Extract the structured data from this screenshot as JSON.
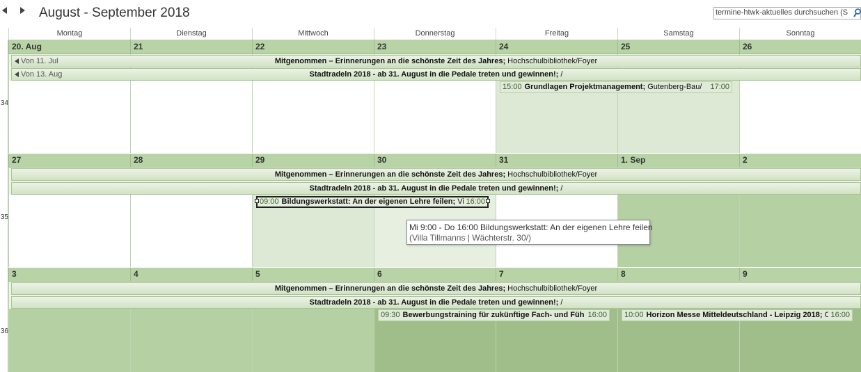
{
  "header": {
    "title": "August - September 2018",
    "search_placeholder": "termine-htwk-aktuelles durchsuchen (S"
  },
  "day_names": [
    "Montag",
    "Dienstag",
    "Mittwoch",
    "Donnerstag",
    "Freitag",
    "Samstag",
    "Sonntag"
  ],
  "weeks": [
    {
      "week_number": "34",
      "dates": [
        "20. Aug",
        "21",
        "22",
        "23",
        "24",
        "25",
        "26"
      ],
      "bars": [
        {
          "from": "Von 11. Jul",
          "title": "Mitgenommen – Erinnerungen an die schönste Zeit des Jahres;",
          "location": "Hochschulbibliothek/Foyer"
        },
        {
          "from": "Von 13. Aug",
          "title": "Stadtradeln 2018 - ab 31. August in die Pedale treten und gewinnen!;",
          "location": "/"
        }
      ],
      "events": [
        {
          "start": "15:00",
          "title": "Grundlagen Projektmanagement;",
          "location": "Gutenberg-Bau/",
          "end": "17:00"
        }
      ]
    },
    {
      "week_number": "35",
      "dates": [
        "27",
        "28",
        "29",
        "30",
        "31",
        "1. Sep",
        "2"
      ],
      "bars": [
        {
          "from": "",
          "title": "Mitgenommen – Erinnerungen an die schönste Zeit des Jahres;",
          "location": "Hochschulbibliothek/Foyer"
        },
        {
          "from": "",
          "title": "Stadtradeln 2018 - ab 31. August in die Pedale treten und gewinnen!;",
          "location": "/"
        }
      ],
      "events": [
        {
          "start": "09:00",
          "title": "Bildungswerkstatt: An der eigenen Lehre feilen;",
          "location": "Vi",
          "end": "16:00"
        }
      ]
    },
    {
      "week_number": "36",
      "dates": [
        "3",
        "4",
        "5",
        "6",
        "7",
        "8",
        "9"
      ],
      "bars": [
        {
          "from": "",
          "title": "Mitgenommen – Erinnerungen an die schönste Zeit des Jahres;",
          "location": "Hochschulbibliothek/Foyer"
        },
        {
          "from": "",
          "title": "Stadtradeln 2018 - ab 31. August in die Pedale treten und gewinnen!;",
          "location": "/"
        }
      ],
      "events": [
        {
          "start": "09:30",
          "title": "Bewerbungstraining für zukünftige Fach- und Füh",
          "location": "",
          "end": "16:00"
        },
        {
          "start": "10:00",
          "title": "Horizon Messe Mitteldeutschland - Leipzig 2018;",
          "location": "C",
          "end": "16:00"
        }
      ]
    }
  ],
  "tooltip": {
    "line1": "Mi 9:00 - Do 16:00  Bildungswerkstatt: An der eigenen Lehre feilen",
    "line2": "(Villa Tillmanns | Wächterstr. 30/)"
  }
}
